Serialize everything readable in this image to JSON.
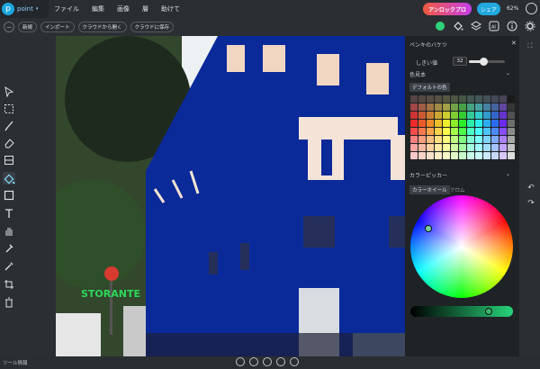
{
  "app": {
    "logo_letter": "p",
    "name": "point"
  },
  "menu": [
    {
      "label": "ファイル"
    },
    {
      "label": "編集"
    },
    {
      "label": "画像"
    },
    {
      "label": "層"
    },
    {
      "label": "助けて"
    }
  ],
  "header": {
    "unlock_label": "アンロックプロ",
    "share_label": "シェア",
    "zoom": "62%"
  },
  "toolbar": {
    "new_label": "新規",
    "import_label": "インポート",
    "cloud_open_label": "クラウドから開く",
    "cloud_save_label": "クラウドに保存"
  },
  "panel": {
    "title": "ペンキのバケツ",
    "threshold_label": "しきい値",
    "threshold_value": "32",
    "threshold_fraction": 0.4,
    "color_sample_label": "色見本",
    "default_tab": "デフォルトの色",
    "color_picker_label": "カラーピッカー",
    "wheel_tab": "カラーホイール",
    "chrome_tab": "クロム",
    "selected_color": "#2fd17a",
    "lightness_fraction": 0.76
  },
  "status": {
    "tools_label": "ツール情報"
  },
  "colors": {
    "accent": "#21a8de",
    "selected": "#2fd17a",
    "fill": "#0a2a9a"
  }
}
